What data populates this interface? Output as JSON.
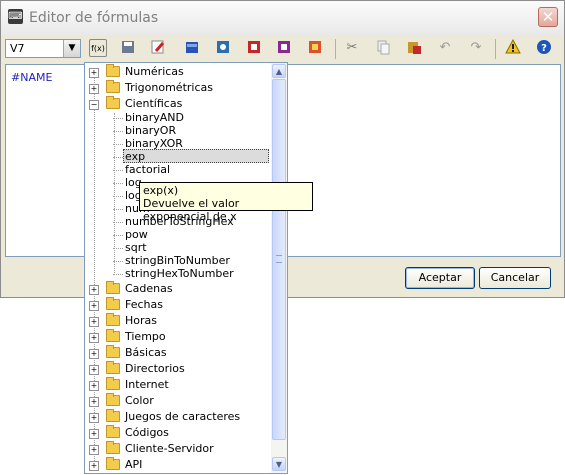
{
  "window": {
    "title": "Editor de fórmulas",
    "close_label": "✕"
  },
  "toolbar": {
    "cell_combo_value": "V7",
    "icons": [
      "formula-fx-icon",
      "save-icon",
      "pen-icon",
      "folder-open-icon",
      "document-icon",
      "pdf-icon",
      "database-icon",
      "export-icon",
      "cut-icon",
      "copy-icon",
      "paste-icon",
      "undo-icon",
      "redo-icon",
      "warning-icon",
      "help-icon"
    ]
  },
  "editor": {
    "text": "#NAME"
  },
  "buttons": {
    "accept": "Aceptar",
    "cancel": "Cancelar"
  },
  "tree": {
    "top_nodes": [
      "Numéricas",
      "Trigonométricas",
      "Científicas"
    ],
    "cientificas_items": [
      "binaryAND",
      "binaryOR",
      "binaryXOR",
      "exp",
      "factorial",
      "log",
      "log10",
      "numberToString",
      "numberToStringHex",
      "pow",
      "sqrt",
      "stringBinToNumber",
      "stringHexToNumber"
    ],
    "visible_leaf_labels": [
      "binaryAND",
      "binaryOR",
      "binaryXOR",
      "exp",
      "factorial",
      "log",
      "log",
      "num",
      "numberToStringHex",
      "pow",
      "sqrt",
      "stringBinToNumber",
      "stringHexToNumber"
    ],
    "selected": "exp",
    "bottom_nodes": [
      "Cadenas",
      "Fechas",
      "Horas",
      "Tiempo",
      "Básicas",
      "Directorios",
      "Internet",
      "Color",
      "Juegos de caracteres",
      "Códigos",
      "Cliente-Servidor",
      "API"
    ]
  },
  "tooltip": {
    "line1": "exp(x)",
    "line2": "Devuelve el valor exponencial de x"
  }
}
